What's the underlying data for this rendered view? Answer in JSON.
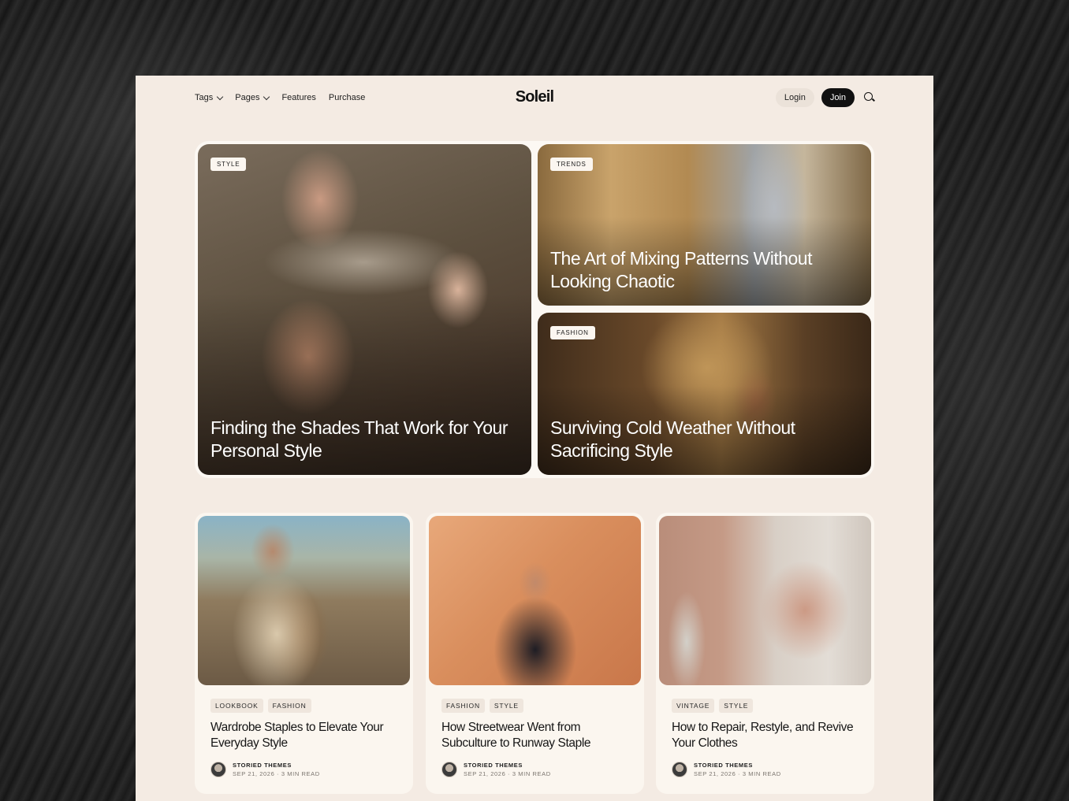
{
  "header": {
    "nav": [
      {
        "label": "Tags",
        "has_dropdown": true
      },
      {
        "label": "Pages",
        "has_dropdown": true
      },
      {
        "label": "Features",
        "has_dropdown": false
      },
      {
        "label": "Purchase",
        "has_dropdown": false
      }
    ],
    "brand": "Soleil",
    "login_label": "Login",
    "join_label": "Join",
    "search_icon": "search-icon"
  },
  "hero": {
    "main": {
      "tag": "STYLE",
      "title": "Finding the Shades That Work for Your Personal Style"
    },
    "top": {
      "tag": "TRENDS",
      "title": "The Art of Mixing Patterns Without Looking Chaotic"
    },
    "bottom": {
      "tag": "FASHION",
      "title": "Surviving Cold Weather Without Sacrificing Style"
    }
  },
  "articles": [
    {
      "tags": [
        "LOOKBOOK",
        "FASHION"
      ],
      "title": "Wardrobe Staples to Elevate Your Everyday Style",
      "author": "STORIED THEMES",
      "date": "SEP 21, 2026",
      "read_time": "3 MIN READ"
    },
    {
      "tags": [
        "FASHION",
        "STYLE"
      ],
      "title": "How Streetwear Went from Subculture to Runway Staple",
      "author": "STORIED THEMES",
      "date": "SEP 21, 2026",
      "read_time": "3 MIN READ"
    },
    {
      "tags": [
        "VINTAGE",
        "STYLE"
      ],
      "title": "How to Repair, Restyle, and Revive Your Clothes",
      "author": "STORIED THEMES",
      "date": "SEP 21, 2026",
      "read_time": "3 MIN READ"
    }
  ],
  "colors": {
    "page_bg": "#f4ebe3",
    "card_bg": "#fbf6ef",
    "join_button": "#111111",
    "outer_bg": "#1d1d1d"
  }
}
